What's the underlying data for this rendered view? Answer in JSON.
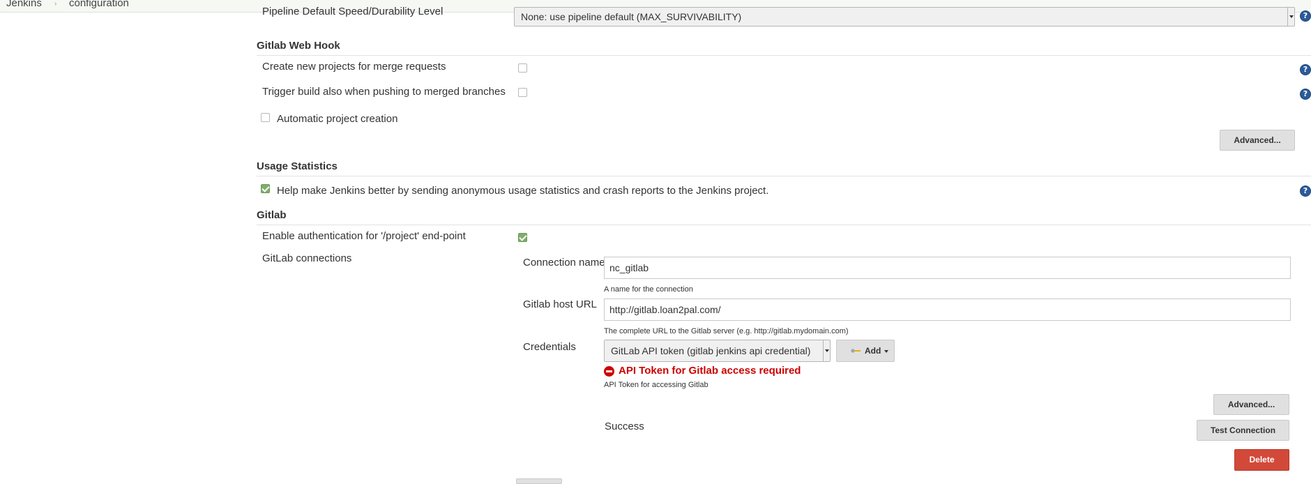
{
  "breadcrumb": {
    "root": "Jenkins",
    "separator": "›",
    "current": "configuration"
  },
  "pipeline": {
    "label": "Pipeline Default Speed/Durability Level",
    "selected": "None: use pipeline default (MAX_SURVIVABILITY)"
  },
  "gitlab_webhook": {
    "title": "Gitlab Web Hook",
    "create_projects_label": "Create new projects for merge requests",
    "trigger_build_label": "Trigger build also when pushing to merged branches",
    "auto_creation_label": "Automatic project creation",
    "advanced_label": "Advanced..."
  },
  "usage": {
    "title": "Usage Statistics",
    "label": "Help make Jenkins better by sending anonymous usage statistics and crash reports to the Jenkins project."
  },
  "gitlab": {
    "title": "Gitlab",
    "auth_label": "Enable authentication for '/project' end-point",
    "connections_label": "GitLab connections",
    "connection_name_label": "Connection name",
    "connection_name_value": "nc_gitlab",
    "connection_name_hint": "A name for the connection",
    "host_url_label": "Gitlab host URL",
    "host_url_value": "http://gitlab.loan2pal.com/",
    "host_url_hint": "The complete URL to the Gitlab server (e.g. http://gitlab.mydomain.com)",
    "credentials_label": "Credentials",
    "credentials_selected": "GitLab API token (gitlab jenkins api credential)",
    "add_label": "Add",
    "error_text": "API Token for Gitlab access required",
    "credentials_hint": "API Token for accessing Gitlab",
    "advanced_label": "Advanced...",
    "status_text": "Success",
    "test_label": "Test Connection",
    "delete_label": "Delete"
  },
  "icons": {
    "help": "?"
  },
  "colors": {
    "checked": "#7fae6a",
    "error": "#cc0000",
    "delete": "#d24939",
    "help": "#2a5b9a"
  }
}
